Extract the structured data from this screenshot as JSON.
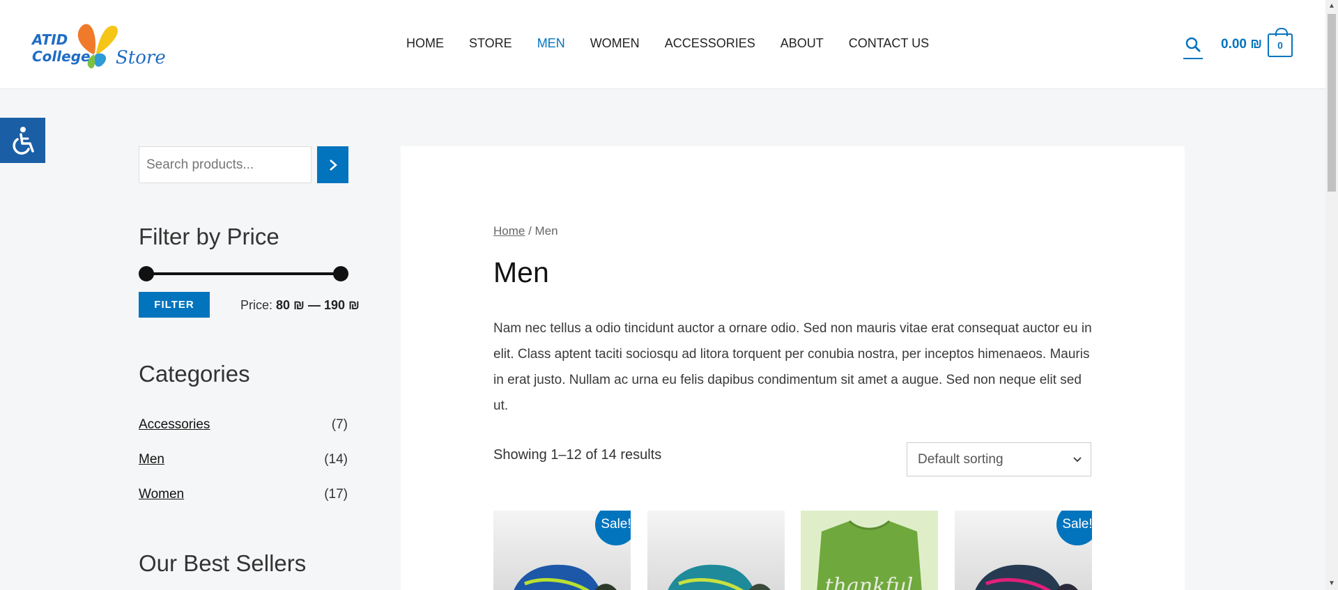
{
  "logo": {
    "line1": "ATID",
    "line2": "College",
    "line3": "Store"
  },
  "nav": {
    "items": [
      {
        "label": "HOME",
        "active": false
      },
      {
        "label": "STORE",
        "active": false
      },
      {
        "label": "MEN",
        "active": true
      },
      {
        "label": "WOMEN",
        "active": false
      },
      {
        "label": "ACCESSORIES",
        "active": false
      },
      {
        "label": "ABOUT",
        "active": false
      },
      {
        "label": "CONTACT US",
        "active": false
      }
    ]
  },
  "header": {
    "cart_amount": "0.00 ₪",
    "cart_count": "0",
    "search_icon": "search-icon",
    "cart_icon": "bag-icon"
  },
  "accessibility": {
    "icon": "wheelchair-icon"
  },
  "sidebar": {
    "search_placeholder": "Search products...",
    "filter_heading": "Filter by Price",
    "filter_button": "FILTER",
    "price_label": "Price:",
    "price_min": "80 ₪",
    "price_sep": "—",
    "price_max": "190 ₪",
    "categories_heading": "Categories",
    "categories": [
      {
        "name": "Accessories",
        "count": "(7)"
      },
      {
        "name": "Men",
        "count": "(14)"
      },
      {
        "name": "Women",
        "count": "(17)"
      }
    ],
    "best_sellers_heading": "Our Best Sellers"
  },
  "main": {
    "breadcrumb_home": "Home",
    "breadcrumb_sep": " / ",
    "breadcrumb_current": "Men",
    "title": "Men",
    "description": "Nam nec tellus a odio tincidunt auctor a ornare odio. Sed non mauris vitae erat consequat auctor eu in elit. Class aptent taciti sociosqu ad litora torquent per conubia nostra, per inceptos himenaeos. Mauris in erat justo. Nullam ac urna eu felis dapibus condimentum sit amet a augue. Sed non neque elit sed ut.",
    "results": "Showing 1–12 of 14 results",
    "sorting": "Default sorting"
  },
  "products": [
    {
      "image": "blue-sneaker",
      "sale": "Sale!"
    },
    {
      "image": "teal-sneaker",
      "sale": ""
    },
    {
      "image": "green-tshirt",
      "sale": ""
    },
    {
      "image": "pink-sneaker",
      "sale": "Sale!"
    }
  ],
  "colors": {
    "accent": "#0274be",
    "background": "#f5f6f7"
  }
}
